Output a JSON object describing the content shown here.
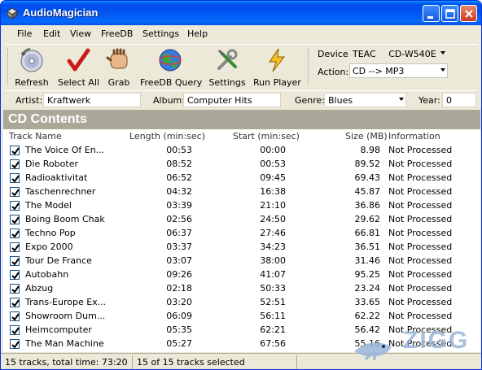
{
  "window": {
    "title": "AudioMagician"
  },
  "menu": [
    "File",
    "Edit",
    "View",
    "FreeDB",
    "Settings",
    "Help"
  ],
  "toolbar": {
    "refresh": "Refresh",
    "select_all": "Select All",
    "grab": "Grab",
    "freedb_query": "FreeDB Query",
    "settings": "Settings",
    "run_player": "Run Player"
  },
  "device": {
    "label": "Device:",
    "vendor": "TEAC",
    "model": "CD-W540E"
  },
  "action": {
    "label": "Action:",
    "value": "CD --> MP3"
  },
  "info": {
    "artist_label": "Artist:",
    "artist": "Kraftwerk",
    "album_label": "Album:",
    "album": "Computer Hits",
    "genre_label": "Genre:",
    "genre": "Blues",
    "year_label": "Year:",
    "year": "0"
  },
  "section_title": "CD Contents",
  "columns": [
    "Track Name",
    "Length (min:sec)",
    "Start (min:sec)",
    "Size (MB)",
    "Information"
  ],
  "tracks": [
    {
      "name": "The Voice Of En...",
      "length": "00:53",
      "start": "00:00",
      "size": "8.98",
      "info": "Not Processed"
    },
    {
      "name": "Die Roboter",
      "length": "08:52",
      "start": "00:53",
      "size": "89.52",
      "info": "Not Processed"
    },
    {
      "name": "Radioaktivitat",
      "length": "06:52",
      "start": "09:45",
      "size": "69.43",
      "info": "Not Processed"
    },
    {
      "name": "Taschenrechner",
      "length": "04:32",
      "start": "16:38",
      "size": "45.87",
      "info": "Not Processed"
    },
    {
      "name": "The Model",
      "length": "03:39",
      "start": "21:10",
      "size": "36.86",
      "info": "Not Processed"
    },
    {
      "name": "Boing Boom Chak",
      "length": "02:56",
      "start": "24:50",
      "size": "29.62",
      "info": "Not Processed"
    },
    {
      "name": "Techno Pop",
      "length": "06:37",
      "start": "27:46",
      "size": "66.81",
      "info": "Not Processed"
    },
    {
      "name": "Expo 2000",
      "length": "03:37",
      "start": "34:23",
      "size": "36.51",
      "info": "Not Processed"
    },
    {
      "name": "Tour De France",
      "length": "03:07",
      "start": "38:00",
      "size": "31.46",
      "info": "Not Processed"
    },
    {
      "name": "Autobahn",
      "length": "09:26",
      "start": "41:07",
      "size": "95.25",
      "info": "Not Processed"
    },
    {
      "name": "Abzug",
      "length": "02:18",
      "start": "50:33",
      "size": "23.24",
      "info": "Not Processed"
    },
    {
      "name": "Trans-Europe Ex...",
      "length": "03:20",
      "start": "52:51",
      "size": "33.65",
      "info": "Not Processed"
    },
    {
      "name": "Showroom Dum...",
      "length": "06:09",
      "start": "56:11",
      "size": "62.22",
      "info": "Not Processed"
    },
    {
      "name": "Heimcomputer",
      "length": "05:35",
      "start": "62:21",
      "size": "56.42",
      "info": "Not Processed"
    },
    {
      "name": "The Man Machine",
      "length": "05:27",
      "start": "67:56",
      "size": "55.16",
      "info": "Not Processed"
    }
  ],
  "status": {
    "summary": "15 tracks, total time: 73:20",
    "selected": "15 of 15 tracks selected"
  },
  "watermark": "ZIGG",
  "colors": {
    "title_bar": "#0053ee",
    "section_bg": "#aca899",
    "window_bg": "#ece9d8"
  }
}
